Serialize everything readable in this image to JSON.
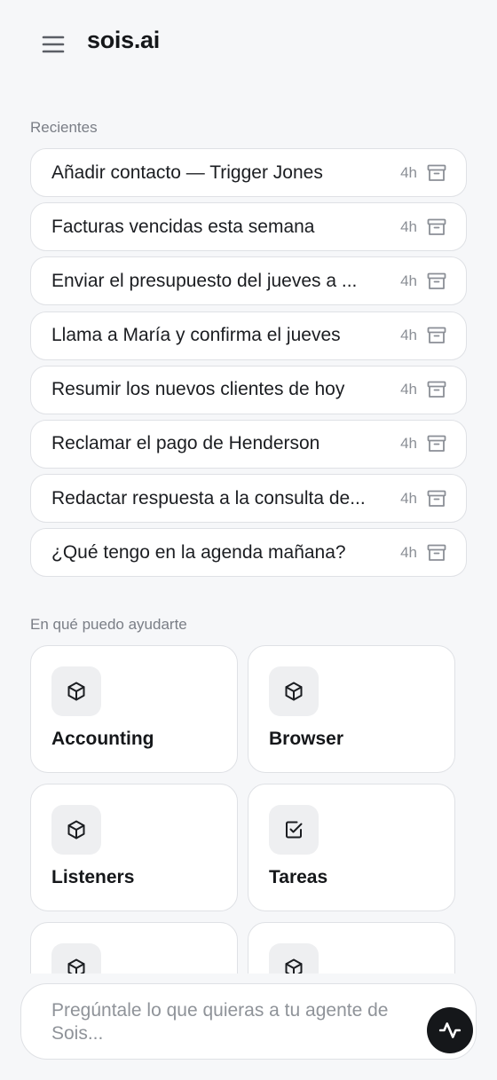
{
  "header": {
    "title": "sois.ai",
    "menu_icon": "hamburger-menu-icon"
  },
  "recents": {
    "label": "Recientes",
    "items": [
      {
        "title": "Añadir contacto — Trigger Jones",
        "time": "4h"
      },
      {
        "title": "Facturas vencidas esta semana",
        "time": "4h"
      },
      {
        "title": "Enviar el presupuesto del jueves a ...",
        "time": "4h"
      },
      {
        "title": "Llama a María y confirma el jueves",
        "time": "4h"
      },
      {
        "title": "Resumir los nuevos clientes de hoy",
        "time": "4h"
      },
      {
        "title": "Reclamar el pago de Henderson",
        "time": "4h"
      },
      {
        "title": "Redactar respuesta a la consulta de...",
        "time": "4h"
      },
      {
        "title": "¿Qué tengo en la agenda mañana?",
        "time": "4h"
      }
    ]
  },
  "help": {
    "label": "En qué puedo ayudarte",
    "cards": [
      {
        "label": "Accounting",
        "icon": "cube-icon"
      },
      {
        "label": "Browser",
        "icon": "cube-icon"
      },
      {
        "label": "Listeners",
        "icon": "cube-icon"
      },
      {
        "label": "Tareas",
        "icon": "checkbox-icon"
      },
      {
        "label": "",
        "icon": "cube-icon"
      },
      {
        "label": "",
        "icon": "cube-icon"
      }
    ]
  },
  "composer": {
    "placeholder": "Pregúntale lo que quieras a tu agente de Sois...",
    "send_icon": "activity-icon"
  },
  "colors": {
    "background": "#f6f7f9",
    "card": "#ffffff",
    "border": "#dfe1e5",
    "accent": "#15171a",
    "muted": "#7a7e86"
  }
}
